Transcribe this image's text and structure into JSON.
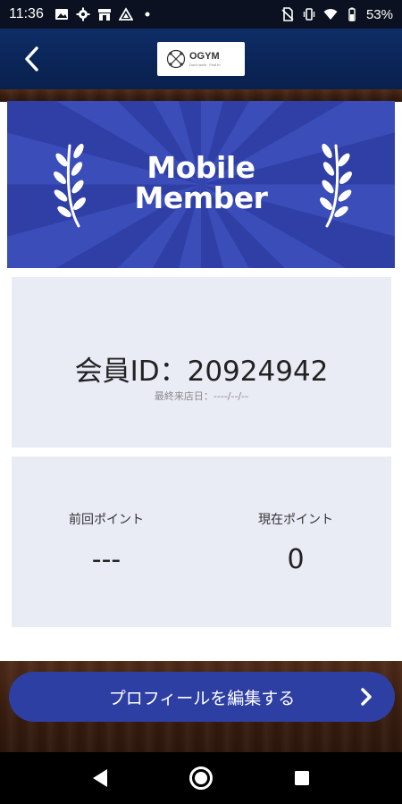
{
  "status_bar": {
    "time": "11:36",
    "battery_text": "53%",
    "left_icons": [
      "image-icon",
      "settings-icon",
      "store-icon",
      "triangle-app-icon",
      "dot-icon"
    ],
    "right_icons": [
      "no-sim-icon",
      "vibrate-icon",
      "wifi-icon",
      "battery-icon"
    ]
  },
  "header": {
    "back_icon": "chevron-left-icon",
    "logo": {
      "brand": "OGYM",
      "tagline": "Don't work · Find It!"
    }
  },
  "banner": {
    "title_line1": "Mobile",
    "title_line2": "Member",
    "colors": {
      "background": "#2f3fa6",
      "rays": "#3a4db8"
    }
  },
  "member_card": {
    "id_label": "会員ID：20924942",
    "last_visit": "最終来店日：----/--/--"
  },
  "points_card": {
    "previous_label": "前回ポイント",
    "previous_value": "---",
    "current_label": "現在ポイント",
    "current_value": "0"
  },
  "edit_profile_button": {
    "label": "プロフィールを編集する",
    "icon": "chevron-right-icon",
    "color": "#2e3fa3"
  },
  "nav_bar": {
    "buttons": [
      "back-triangle-icon",
      "home-circle-icon",
      "recents-square-icon"
    ]
  }
}
